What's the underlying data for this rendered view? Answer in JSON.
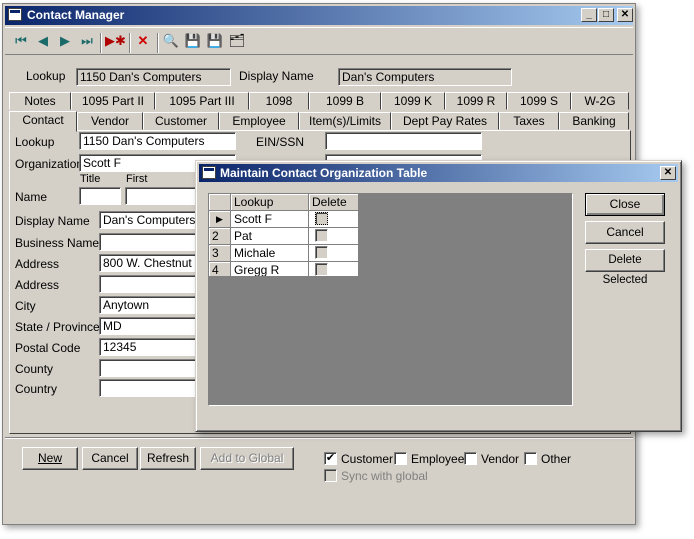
{
  "window": {
    "title": "Contact Manager"
  },
  "toolbar": {
    "icons": [
      "first-record-icon",
      "prev-record-icon",
      "next-record-icon",
      "last-record-icon",
      "new-record-icon",
      "delete-record-icon",
      "find-icon",
      "save-icon",
      "close-save-icon",
      "properties-icon"
    ]
  },
  "header": {
    "lookup_label": "Lookup",
    "lookup_value": "1150 Dan's Computers",
    "display_name_label": "Display Name",
    "display_name_value": "Dan's Computers"
  },
  "tabs_row1": [
    "Notes",
    "1095 Part II",
    "1095 Part III",
    "1098",
    "1099 B",
    "1099 K",
    "1099 R",
    "1099 S",
    "W-2G"
  ],
  "tabs_row2": [
    "Contact",
    "Vendor",
    "Customer",
    "Employee",
    "Item(s)/Limits",
    "Dept Pay Rates",
    "Taxes",
    "Banking"
  ],
  "form": {
    "lookup_label": "Lookup",
    "lookup_value": "1150 Dan's Computers",
    "ein_label": "EIN/SSN",
    "ein_value": "",
    "organization_label": "Organization",
    "organization_value": "Scott F",
    "title_label": "Title",
    "first_label": "First",
    "name_label": "Name",
    "display_name_label": "Display Name",
    "display_name_value": "Dan's Computers",
    "business_name_label": "Business Name",
    "business_name_value": "",
    "address1_label": "Address",
    "address1_value": "800 W. Chestnut St",
    "address2_label": "Address",
    "address2_value": "",
    "city_label": "City",
    "city_value": "Anytown",
    "state_label": "State / Province",
    "state_value": "MD",
    "postal_label": "Postal Code",
    "postal_value": "12345",
    "county_label": "County",
    "county_value": "",
    "country_label": "Country",
    "country_value": ""
  },
  "footer": {
    "new_label": "New",
    "cancel_label": "Cancel",
    "refresh_label": "Refresh",
    "add_global_label": "Add to Global",
    "customer_label": "Customer",
    "customer_checked": true,
    "employee_label": "Employee",
    "employee_checked": false,
    "vendor_label": "Vendor",
    "vendor_checked": false,
    "other_label": "Other",
    "other_checked": false,
    "sync_label": "Sync with global"
  },
  "dialog": {
    "title": "Maintain Contact Organization Table",
    "columns": [
      "Lookup",
      "Delete"
    ],
    "rows": [
      {
        "num": "",
        "lookup": "Scott F",
        "delete": false,
        "current": true
      },
      {
        "num": "2",
        "lookup": "Pat",
        "delete": false
      },
      {
        "num": "3",
        "lookup": "Michale",
        "delete": false
      },
      {
        "num": "4",
        "lookup": "Gregg R",
        "delete": false
      }
    ],
    "close_label": "Close",
    "cancel_label": "Cancel",
    "delete_selected_label": "Delete Selected"
  }
}
